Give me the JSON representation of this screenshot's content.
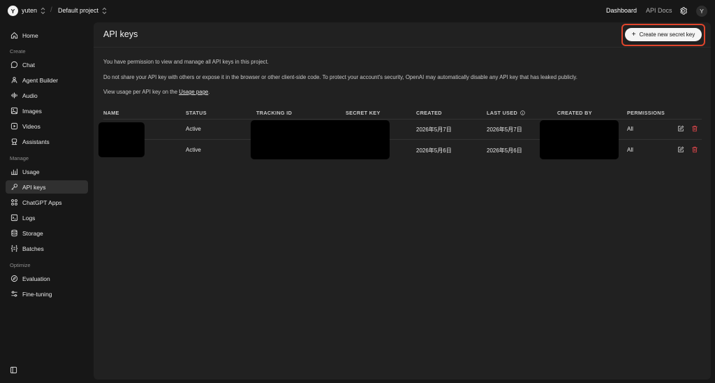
{
  "topbar": {
    "org_initial": "Y",
    "org_name": "yuten",
    "separator": "/",
    "project_name": "Default project",
    "dashboard": "Dashboard",
    "api_docs": "API Docs",
    "user_initial": "Y"
  },
  "sidebar": {
    "home": "Home",
    "sections": {
      "create": "Create",
      "manage": "Manage",
      "optimize": "Optimize"
    },
    "create_items": [
      "Chat",
      "Agent Builder",
      "Audio",
      "Images",
      "Videos",
      "Assistants"
    ],
    "manage_items": [
      "Usage",
      "API keys",
      "ChatGPT Apps",
      "Logs",
      "Storage",
      "Batches"
    ],
    "optimize_items": [
      "Evaluation",
      "Fine-tuning"
    ],
    "active": "API keys"
  },
  "page": {
    "title": "API keys",
    "create_button": "Create new secret key",
    "info_permission": "You have permission to view and manage all API keys in this project.",
    "info_security": "Do not share your API key with others or expose it in the browser or other client-side code. To protect your account's security, OpenAI may automatically disable any API key that has leaked publicly.",
    "info_usage_prefix": "View usage per API key on the ",
    "info_usage_link": "Usage page",
    "info_usage_suffix": "."
  },
  "table": {
    "columns": [
      "NAME",
      "STATUS",
      "TRACKING ID",
      "SECRET KEY",
      "CREATED",
      "LAST USED",
      "CREATED BY",
      "PERMISSIONS"
    ],
    "rows": [
      {
        "status": "Active",
        "created": "2026年5月7日",
        "last_used": "2026年5月7日",
        "permissions": "All"
      },
      {
        "status": "Active",
        "created": "2026年5月6日",
        "last_used": "2026年5月6日",
        "permissions": "All"
      }
    ]
  },
  "colors": {
    "highlight": "#e0452c",
    "delete": "#e5484d",
    "panel": "#212121",
    "background": "#171717"
  }
}
